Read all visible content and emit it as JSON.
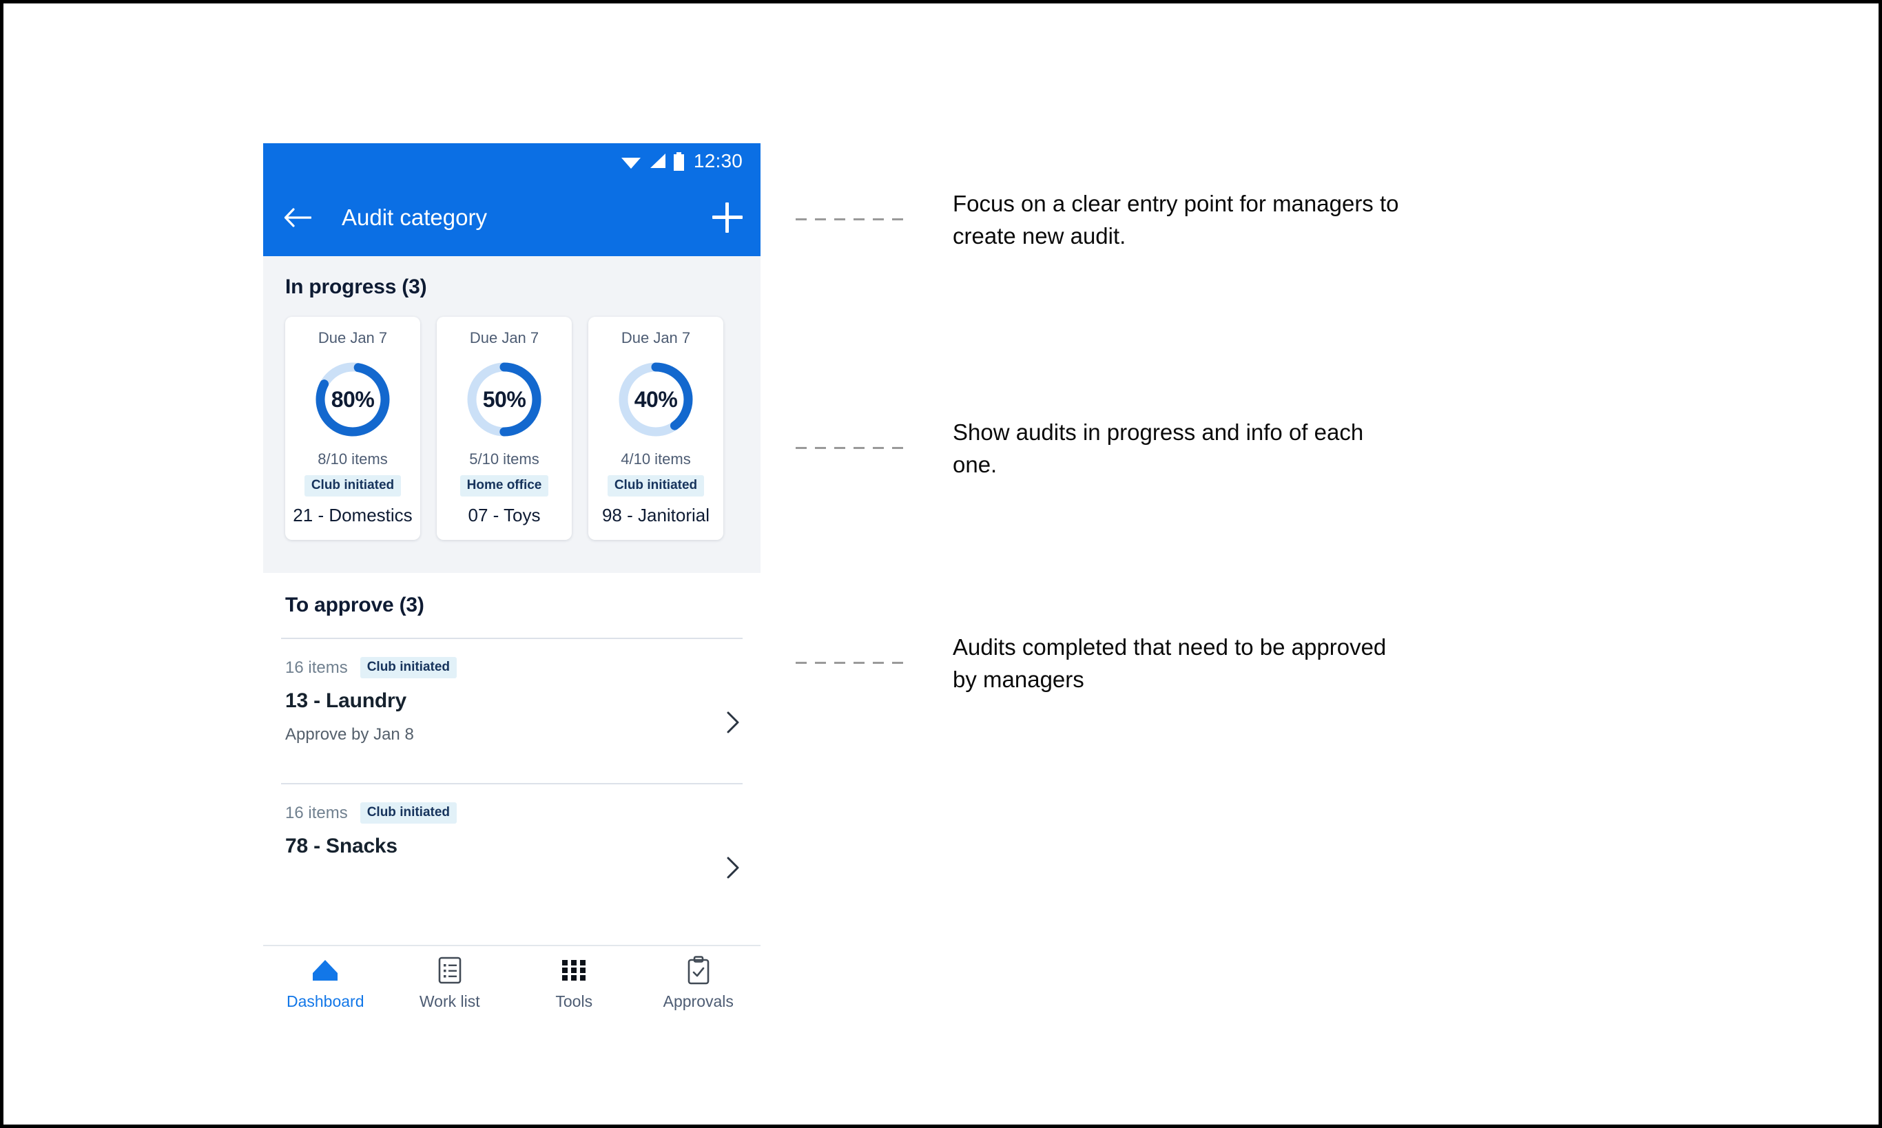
{
  "phone": {
    "status_bar": {
      "time": "12:30",
      "icons": [
        "wifi-icon",
        "signal-icon",
        "battery-icon"
      ]
    },
    "app_bar": {
      "back_icon": "back-arrow-icon",
      "title": "Audit category",
      "add_icon": "plus-icon"
    },
    "in_progress": {
      "title": "In progress (3)",
      "cards": [
        {
          "due": "Due Jan 7",
          "percent_label": "80%",
          "percent": 80,
          "items": "8/10 items",
          "badge": "Club initiated",
          "name": "21 - Domestics"
        },
        {
          "due": "Due Jan 7",
          "percent_label": "50%",
          "percent": 50,
          "items": "5/10 items",
          "badge": "Home office",
          "name": "07 - Toys"
        },
        {
          "due": "Due Jan 7",
          "percent_label": "40%",
          "percent": 40,
          "items": "4/10 items",
          "badge": "Club initiated",
          "name": "98 - Janitorial"
        }
      ]
    },
    "to_approve": {
      "title": "To approve (3)",
      "rows": [
        {
          "items": "16 items",
          "badge": "Club initiated",
          "name": "13 - Laundry",
          "sub": "Approve by Jan 8",
          "chevron": "chevron-right-icon"
        },
        {
          "items": "16 items",
          "badge": "Club initiated",
          "name": "78 - Snacks",
          "sub": "",
          "chevron": "chevron-right-icon"
        }
      ]
    },
    "bottom_nav": {
      "items": [
        {
          "label": "Dashboard",
          "icon": "home-icon",
          "active": true
        },
        {
          "label": "Work list",
          "icon": "list-document-icon",
          "active": false
        },
        {
          "label": "Tools",
          "icon": "grid-dots-icon",
          "active": false
        },
        {
          "label": "Approvals",
          "icon": "clipboard-check-icon",
          "active": false
        }
      ]
    }
  },
  "annotations": [
    {
      "text": "Focus on a clear entry point for managers to\ncreate new audit."
    },
    {
      "text": "Show audits in progress and info of each\none."
    },
    {
      "text": "Audits completed that need to be approved\nby managers"
    }
  ],
  "colors": {
    "brand_blue": "#0B6FE4",
    "ring_fill": "#1368CE",
    "ring_track": "#CBE0F7",
    "badge_bg": "#E2F1F8",
    "gray_section": "#F2F4F7"
  }
}
